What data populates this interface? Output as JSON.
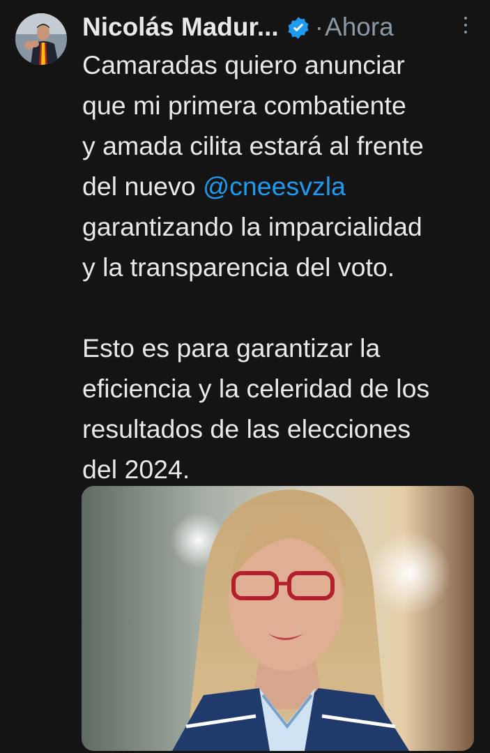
{
  "post": {
    "author_name": "Nicolás Madur...",
    "separator": "·",
    "timestamp": "Ahora",
    "text_lines_1": [
      "Camaradas quiero anunciar",
      "que mi primera combatiente",
      "y amada cilita estará al frente"
    ],
    "text_prefix_mention": "del nuevo ",
    "mention": "@cneesvzla",
    "text_lines_2": [
      "garantizando la imparcialidad",
      "y la transparencia del voto."
    ],
    "paragraph_2_lines": [
      "Esto es para garantizar la",
      "eficiencia y la celeridad de los",
      "resultados de las elecciones",
      "del 2024."
    ]
  },
  "icons": {
    "verified": "verified-badge-icon",
    "more": "more-options-icon"
  },
  "colors": {
    "background": "#141414",
    "text": "#e7e9ea",
    "muted": "#8b98a5",
    "link": "#1d9bf0"
  }
}
